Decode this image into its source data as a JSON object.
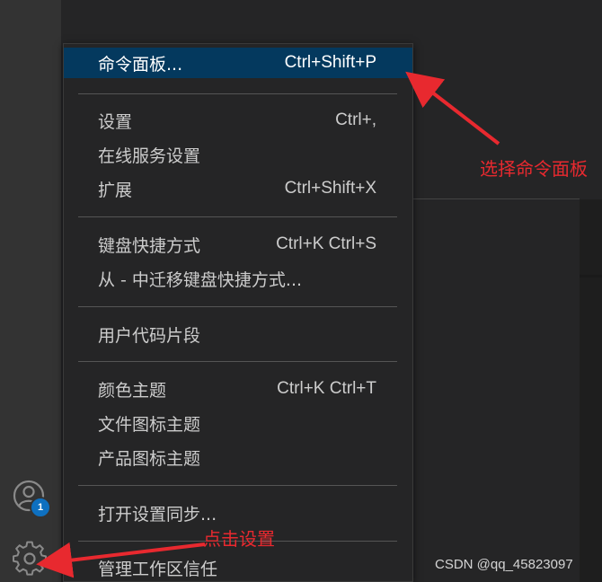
{
  "menu": {
    "items": [
      {
        "label": "命令面板...",
        "shortcut": "Ctrl+Shift+P",
        "active": true
      },
      {
        "label": "设置",
        "shortcut": "Ctrl+,"
      },
      {
        "label": "在线服务设置",
        "shortcut": ""
      },
      {
        "label": "扩展",
        "shortcut": "Ctrl+Shift+X"
      },
      {
        "label": "键盘快捷方式",
        "shortcut": "Ctrl+K Ctrl+S"
      },
      {
        "label": "从 - 中迁移键盘快捷方式...",
        "shortcut": ""
      },
      {
        "label": "用户代码片段",
        "shortcut": ""
      },
      {
        "label": "颜色主题",
        "shortcut": "Ctrl+K Ctrl+T"
      },
      {
        "label": "文件图标主题",
        "shortcut": ""
      },
      {
        "label": "产品图标主题",
        "shortcut": ""
      },
      {
        "label": "打开设置同步...",
        "shortcut": ""
      },
      {
        "label": "管理工作区信任",
        "shortcut": ""
      }
    ]
  },
  "activity_bar": {
    "account_badge": "1",
    "account_icon": "account-icon",
    "settings_icon": "gear-icon"
  },
  "annotations": {
    "select_command_palette": "选择命令面板",
    "click_settings": "点击设置",
    "color": "#e8292f"
  },
  "watermark": "CSDN @qq_45823097",
  "colors": {
    "active_item_bg": "#04395e",
    "badge_bg": "#0e70c0"
  }
}
